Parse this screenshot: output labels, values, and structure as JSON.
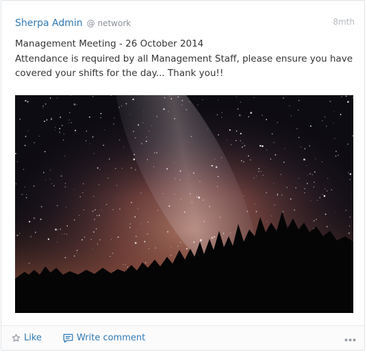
{
  "post": {
    "author": "Sherpa Admin",
    "audience": "@ network",
    "timestamp": "8mth",
    "text_lines": [
      "Management Meeting - 26 October 2014",
      "Attendance is required by all Management Staff, please ensure you have covered your shifts for the day... Thank you!!"
    ],
    "image_icon": "milky-way-night-sky-photo"
  },
  "actions": {
    "like_label": "Like",
    "comment_label": "Write comment",
    "like_icon": "star-outline-icon",
    "comment_icon": "comment-icon",
    "more_icon": "ellipsis-icon"
  },
  "colors": {
    "link": "#2d78b4",
    "text": "#333333",
    "muted": "#8a8f96"
  }
}
